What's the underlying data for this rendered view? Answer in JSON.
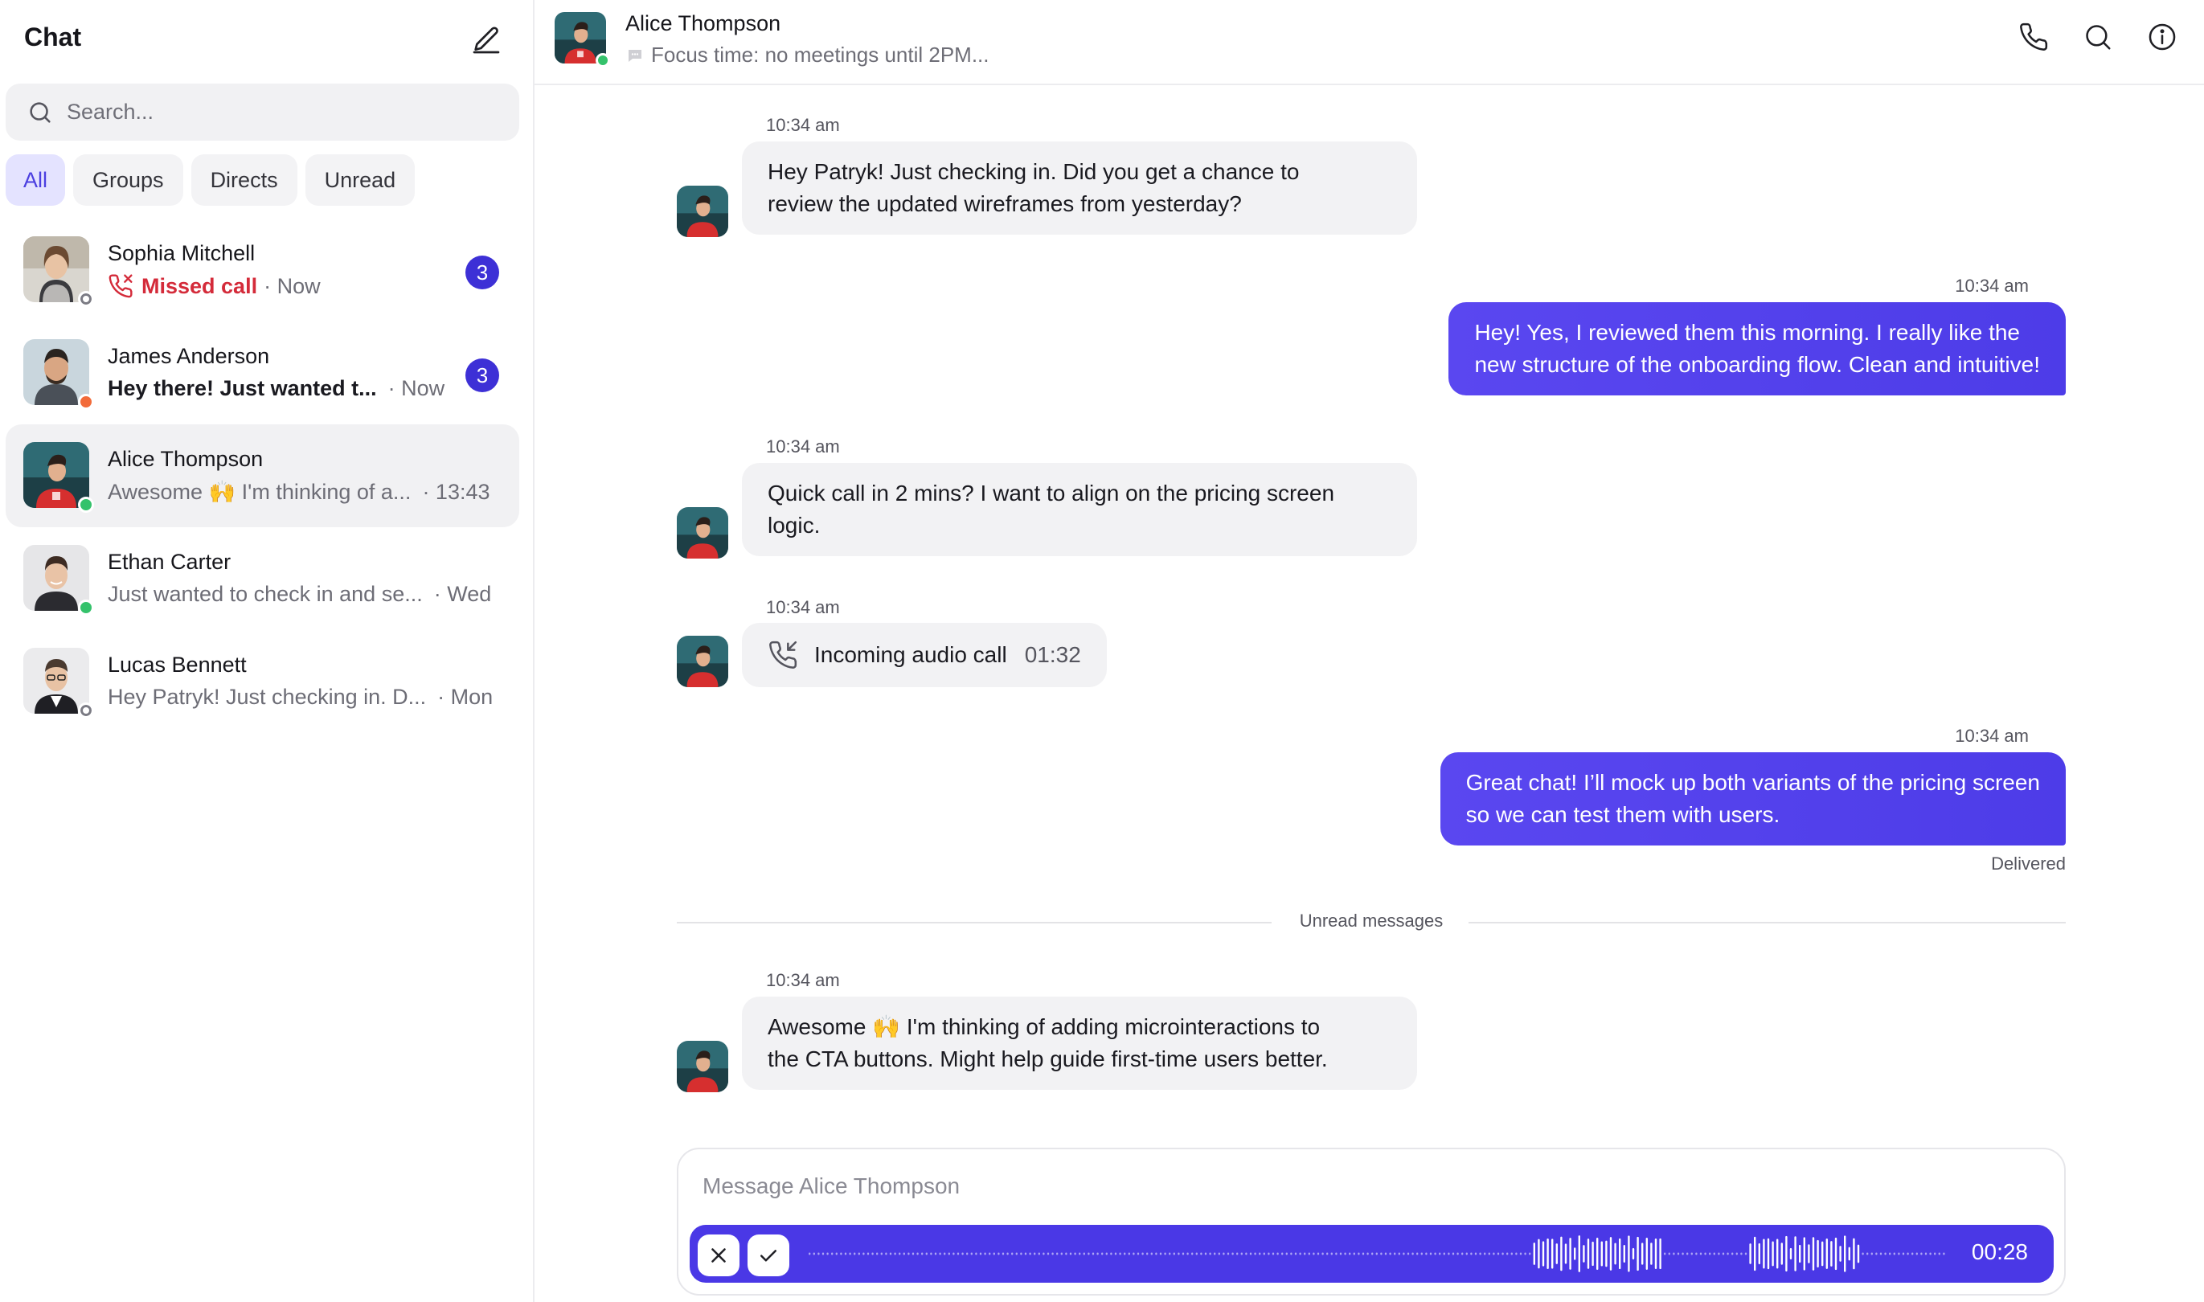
{
  "sidebar": {
    "title": "Chat",
    "search_placeholder": "Search...",
    "filters": [
      "All",
      "Groups",
      "Directs",
      "Unread"
    ],
    "chats": [
      {
        "name": "Sophia Mitchell",
        "preview_label": "Missed call",
        "time": "· Now",
        "unread": "3",
        "presence": "offline"
      },
      {
        "name": "James Anderson",
        "preview": "Hey there! Just wanted t...",
        "time": "· Now",
        "unread": "3",
        "presence": "away"
      },
      {
        "name": "Alice Thompson",
        "preview": "Awesome 🙌 I'm thinking of a...",
        "time": "· 13:43",
        "presence": "online"
      },
      {
        "name": "Ethan Carter",
        "preview": "Just wanted to check in and se...",
        "time": "· Wed",
        "presence": "online"
      },
      {
        "name": "Lucas Bennett",
        "preview": "Hey Patryk! Just checking in. D...",
        "time": "· Mon",
        "presence": "offline"
      }
    ]
  },
  "header": {
    "name": "Alice Thompson",
    "status": "Focus time: no meetings until 2PM..."
  },
  "messages": [
    {
      "time": "10:34 am",
      "line1": "Hey Patryk! Just checking in. Did you get a chance to",
      "line2": "review the updated wireframes from yesterday?"
    },
    {
      "time": "10:34 am",
      "line1": "Hey! Yes, I reviewed them this morning. I really like the",
      "line2": "new structure of the onboarding flow. Clean and intuitive!"
    },
    {
      "time": "10:34 am",
      "line1": "Quick call in 2 mins? I want to align on the pricing screen",
      "line2": "logic."
    },
    {
      "time": "10:34 am",
      "call_label": "Incoming audio call",
      "duration": "01:32"
    },
    {
      "time": "10:34 am",
      "line1": "Great chat! I’ll mock up both variants of the pricing screen",
      "line2": "so we can test them with users.",
      "status": "Delivered"
    },
    {
      "time": "10:34 am",
      "line1": "Awesome 🙌 I'm thinking of adding microinteractions to",
      "line2": "the CTA buttons. Might help guide first-time users better."
    }
  ],
  "divider_label": "Unread messages",
  "composer": {
    "placeholder": "Message Alice Thompson",
    "recording_time": "00:28"
  },
  "colors": {
    "accent": "#4a38e6",
    "badge": "#3d30d6",
    "missed": "#d42b3a",
    "online": "#34c26b"
  }
}
